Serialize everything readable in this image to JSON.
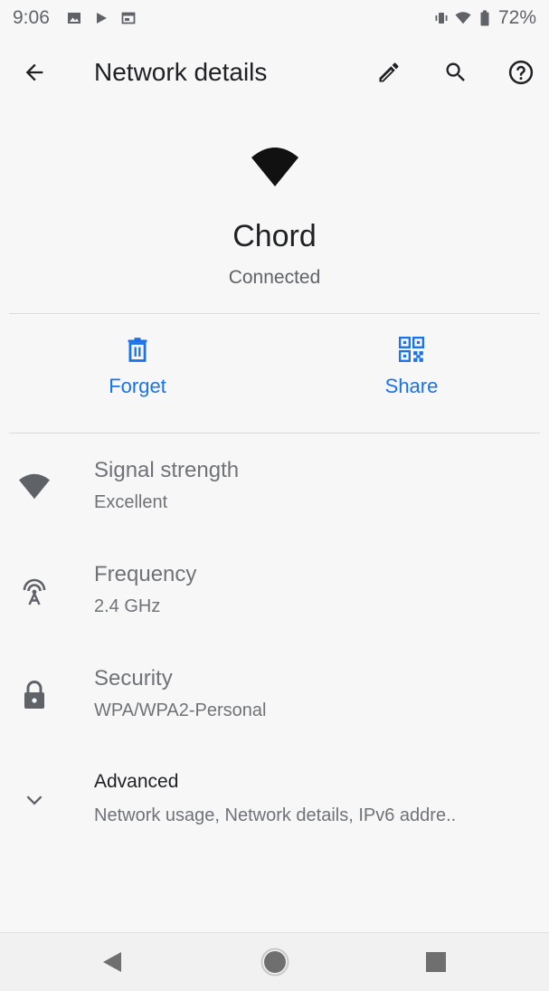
{
  "status_bar": {
    "time": "9:06",
    "battery": "72%",
    "left_icons": [
      "image-icon",
      "play-icon",
      "window-icon"
    ],
    "right_icons": [
      "vibrate-icon",
      "wifi-icon",
      "battery-icon"
    ]
  },
  "app_bar": {
    "title": "Network details",
    "icons": [
      "back-arrow-icon",
      "edit-pencil-icon",
      "search-icon",
      "help-icon"
    ]
  },
  "network": {
    "name": "Chord",
    "status": "Connected",
    "icon": "wifi-icon"
  },
  "actions": [
    {
      "label": "Forget",
      "icon": "trash-icon"
    },
    {
      "label": "Share",
      "icon": "qr-code-icon"
    }
  ],
  "details": [
    {
      "title": "Signal strength",
      "value": "Excellent",
      "icon": "wifi-signal-icon"
    },
    {
      "title": "Frequency",
      "value": "2.4 GHz",
      "icon": "antenna-icon"
    },
    {
      "title": "Security",
      "value": "WPA/WPA2-Personal",
      "icon": "lock-icon"
    },
    {
      "title": "Advanced",
      "value": "Network usage, Network details, IPv6 addre..",
      "icon": "chevron-down-icon"
    }
  ],
  "colors": {
    "accent": "#1a73e8",
    "text_primary": "#202124",
    "text_secondary": "#6f7377",
    "background": "#f7f7f7"
  },
  "nav_bar": {
    "icons": [
      "back-triangle-icon",
      "home-circle-icon",
      "recents-square-icon"
    ]
  }
}
